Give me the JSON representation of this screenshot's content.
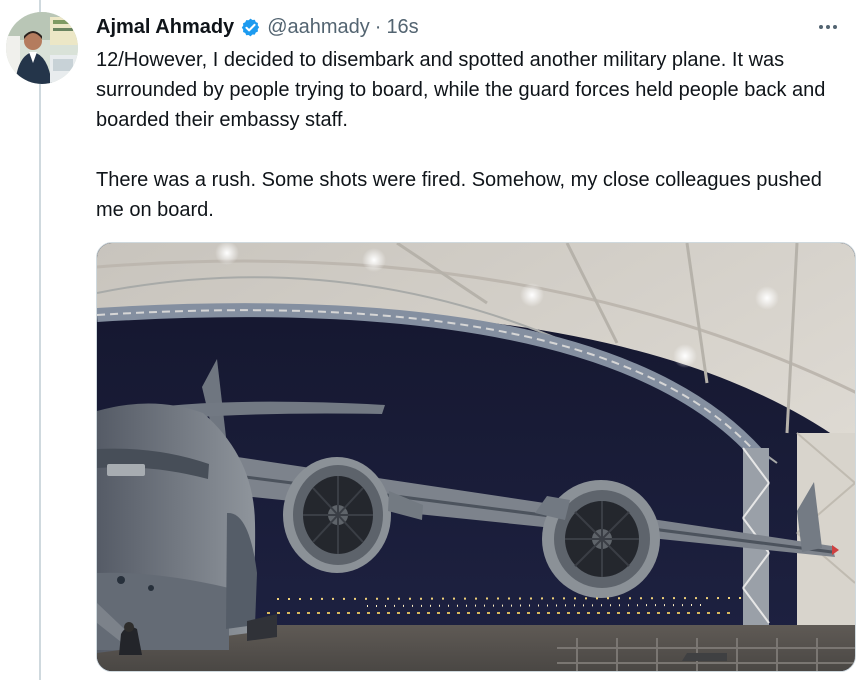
{
  "tweet": {
    "author_name": "Ajmal Ahmady",
    "handle": "@aahmady",
    "separator": "·",
    "timestamp": "16s",
    "paragraphs": [
      "12/However, I decided to disembark and spotted another military plane. It was surrounded by people trying to board, while the guard forces held people back and boarded their embassy staff.",
      "There was a rush. Some shots were fired. Somehow, my close colleagues pushed me on board."
    ]
  },
  "icons": {
    "verified": "verified-badge-icon",
    "more": "more-horizontal-icon"
  },
  "colors": {
    "text_primary": "#0f1419",
    "text_secondary": "#536471",
    "verified_blue": "#1d9bf0",
    "border": "#cfd9de"
  }
}
